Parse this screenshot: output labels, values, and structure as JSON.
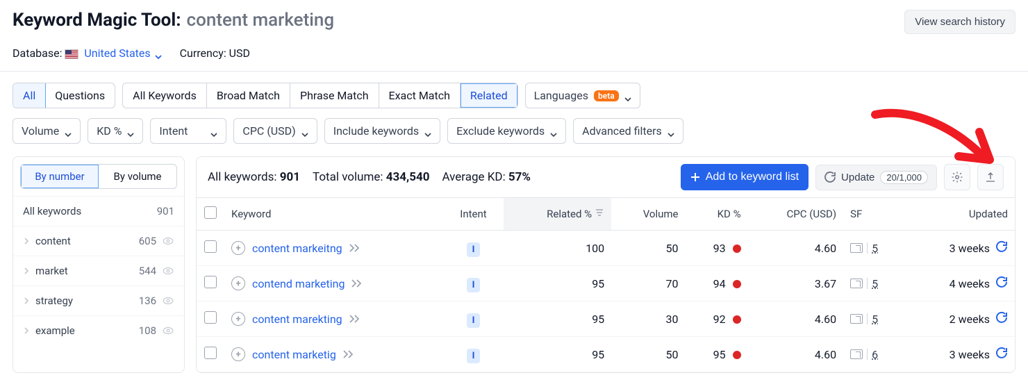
{
  "header": {
    "tool_name": "Keyword Magic Tool:",
    "query": "content marketing",
    "history_btn": "View search history",
    "database_label": "Database:",
    "database_value": "United States",
    "currency_label": "Currency:",
    "currency_value": "USD"
  },
  "tabs": {
    "mode": {
      "all": "All",
      "questions": "Questions"
    },
    "match": {
      "all": "All Keywords",
      "broad": "Broad Match",
      "phrase": "Phrase Match",
      "exact": "Exact Match",
      "related": "Related"
    },
    "languages": "Languages",
    "beta": "beta"
  },
  "filters": {
    "volume": "Volume",
    "kd": "KD %",
    "intent": "Intent",
    "cpc": "CPC (USD)",
    "include": "Include keywords",
    "exclude": "Exclude keywords",
    "advanced": "Advanced filters"
  },
  "sidebar": {
    "by_number": "By number",
    "by_volume": "By volume",
    "all_label": "All keywords",
    "all_count": "901",
    "groups": [
      {
        "name": "content",
        "count": "605"
      },
      {
        "name": "market",
        "count": "544"
      },
      {
        "name": "strategy",
        "count": "136"
      },
      {
        "name": "example",
        "count": "108"
      }
    ]
  },
  "summary": {
    "all_label": "All keywords:",
    "all_value": "901",
    "vol_label": "Total volume:",
    "vol_value": "434,540",
    "kd_label": "Average KD:",
    "kd_value": "57%"
  },
  "actions": {
    "add_list": "Add to keyword list",
    "update": "Update",
    "update_count": "20/1,000"
  },
  "columns": {
    "keyword": "Keyword",
    "intent": "Intent",
    "related": "Related %",
    "volume": "Volume",
    "kd": "KD %",
    "cpc": "CPC (USD)",
    "sf": "SF",
    "updated": "Updated"
  },
  "rows": [
    {
      "keyword": "content markeitng",
      "intent": "I",
      "related": "100",
      "volume": "50",
      "kd": "93",
      "cpc": "4.60",
      "sf": "5",
      "updated": "3 weeks"
    },
    {
      "keyword": "contend marketing",
      "intent": "I",
      "related": "95",
      "volume": "70",
      "kd": "94",
      "cpc": "3.67",
      "sf": "5",
      "updated": "4 weeks"
    },
    {
      "keyword": "content marekting",
      "intent": "I",
      "related": "95",
      "volume": "30",
      "kd": "92",
      "cpc": "4.60",
      "sf": "5",
      "updated": "2 weeks"
    },
    {
      "keyword": "content marketig",
      "intent": "I",
      "related": "95",
      "volume": "50",
      "kd": "95",
      "cpc": "4.60",
      "sf": "6",
      "updated": "3 weeks"
    }
  ]
}
